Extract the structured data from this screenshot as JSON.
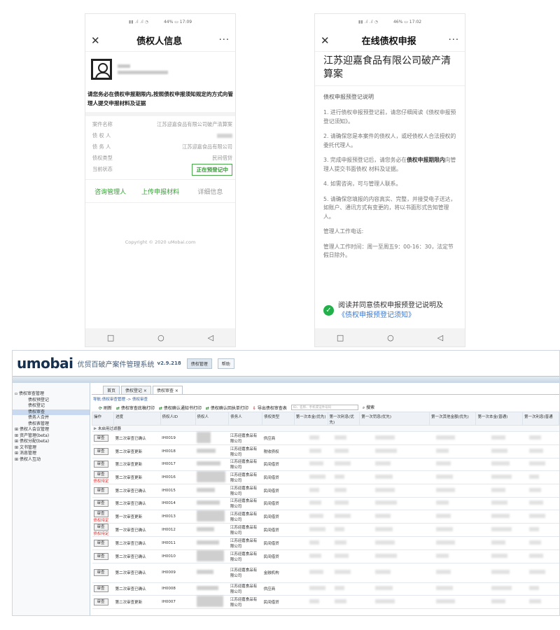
{
  "phone1": {
    "status_left": "44%",
    "status_time": "17:09",
    "title": "债权人信息",
    "close_icon": "close-icon",
    "more_icon": "more-icon",
    "notice": "请您务必在债权申报期限内,按照债权申报须知规定的方式向管理人提交申报材料及证据",
    "rows": [
      {
        "label": "案件名称",
        "value": "江苏迎嘉食品有限公司破产清算案"
      },
      {
        "label": "债 权 人",
        "value": ""
      },
      {
        "label": "债 务 人",
        "value": "江苏迎嘉食品有限公司"
      },
      {
        "label": "债权类型",
        "value": "民间借贷"
      },
      {
        "label": "当前状态",
        "value": "正在预登记中"
      }
    ],
    "actions": [
      "咨询管理人",
      "上传申报材料",
      "详细信息"
    ],
    "copyright": "Copyright © 2020 uMobai.com"
  },
  "phone2": {
    "status_left": "46%",
    "status_time": "17:02",
    "title": "在线债权申报",
    "case_title": "江苏迎嘉食品有限公司破产清算案",
    "section": "债权申报预登记说明",
    "paras": [
      "1. 进行债权申报预登记前，请您仔细阅读《债权申报预登记须知》。",
      "2. 请确保您是本案件的债权人，或经债权人合法授权的委托代理人。",
      "4. 如需咨询，可与管理人联系。",
      "5. 请确保您填报的内容真实、完整，并接受电子送达，如账户、通讯方式有变更的，将以书面形式告知管理人。",
      "管理人工作电话:",
      "管理人工作时间：周一至周五9：00-16：30，法定节假日除外。"
    ],
    "para3_pre": "3. 完成申报预登记后，请您务必在",
    "para3_bold": "债权申报期限内",
    "para3_post": "向管理人提交书面债权 材料及证据。",
    "agree_text": "阅读并同意债权申报预登记说明及",
    "agree_link": "《债权申报预登记须知》"
  },
  "desktop": {
    "logo": "umobai",
    "system_name": "优贸百破产案件管理系统",
    "version": "v2.9.218",
    "header_tabs": [
      "债权管理",
      "帮助"
    ],
    "sidebar": [
      {
        "label": "债权审查管理",
        "level": 0
      },
      {
        "label": "债权预登记",
        "level": 1
      },
      {
        "label": "债权登记",
        "level": 1
      },
      {
        "label": "债权审查",
        "level": 1,
        "selected": true
      },
      {
        "label": "债务人合并",
        "level": 1
      },
      {
        "label": "债权表管理",
        "level": 1
      },
      {
        "label": "债权人会议管理",
        "level": 0
      },
      {
        "label": "资产管理(beta)",
        "level": 0
      },
      {
        "label": "债权分配(beta)",
        "level": 0
      },
      {
        "label": "文书管理",
        "level": 0
      },
      {
        "label": "消息管理",
        "level": 0
      },
      {
        "label": "债权人互动",
        "level": 0
      }
    ],
    "tabs": [
      "首页",
      "债权登记 ×",
      "债权审查 ×"
    ],
    "breadcrumb": "导航:债权审查管理 -> 债权审查",
    "toolbar": [
      "刷新",
      "债权审查底稿打印",
      "债权确认通知书打印",
      "债权确认回执单打印",
      "导出债权审查表"
    ],
    "search_placeholder": "ID、名称、手机或证件号码",
    "search_button": "搜索",
    "columns": [
      "操作",
      "进度",
      "债权人ID",
      "债权人",
      "债务人",
      "债权类型",
      "第一次本金(优先)",
      "第一次利息(优先)",
      "第一次罚息(优先)",
      "第一次其他金额(优先)",
      "第一次本金(普通)",
      "第一次利息(普通"
    ],
    "filter_label": "未启用过滤器",
    "rows": [
      {
        "btn": "审查",
        "tag": "",
        "status": "第二次审查已确认",
        "id": "IH0019",
        "debtor": "江苏迎嘉食品有限公司",
        "type": "供应商"
      },
      {
        "btn": "审查",
        "tag": "",
        "status": "第二次审查更新",
        "id": "IH0018",
        "debtor": "江苏迎嘉食品有限公司",
        "type": "税收债权"
      },
      {
        "btn": "审查",
        "tag": "",
        "status": "第二次审查更新",
        "id": "IH0017",
        "debtor": "江苏迎嘉食品有限公司",
        "type": "民间借贷"
      },
      {
        "btn": "审查",
        "tag": "债权待定",
        "status": "第二次审查更新",
        "id": "IH0016",
        "debtor": "江苏迎嘉食品有限公司",
        "type": "民间借贷"
      },
      {
        "btn": "审查",
        "tag": "",
        "status": "第二次审查已确认",
        "id": "IH0015",
        "debtor": "江苏迎嘉食品有限公司",
        "type": "民间借贷"
      },
      {
        "btn": "审查",
        "tag": "",
        "status": "第二次审查已确认",
        "id": "IH0014",
        "debtor": "江苏迎嘉食品有限公司",
        "type": "民间借贷"
      },
      {
        "btn": "审查",
        "tag": "债权待定",
        "status": "第一次审查更新",
        "id": "IH0013",
        "debtor": "江苏迎嘉食品有限公司",
        "type": "民间借贷"
      },
      {
        "btn": "审查",
        "tag": "债权待定",
        "status": "第一次审查已确认",
        "id": "IH0012",
        "debtor": "江苏迎嘉食品有限公司",
        "type": "民间借贷"
      },
      {
        "btn": "审查",
        "tag": "",
        "status": "第二次审查已确认",
        "id": "IH0011",
        "debtor": "江苏迎嘉食品有限公司",
        "type": "民间借贷"
      },
      {
        "btn": "审查",
        "tag": "",
        "status": "第二次审查已确认",
        "id": "IH0010",
        "debtor": "江苏迎嘉食品有限公司",
        "type": "民间借贷"
      },
      {
        "btn": "审查",
        "tag": "",
        "status": "第二次审查已确认",
        "id": "IH0009",
        "debtor": "江苏迎嘉食品有限公司",
        "type": "金融机构"
      },
      {
        "btn": "审查",
        "tag": "",
        "status": "第二次审查已确认",
        "id": "IH0008",
        "debtor": "江苏迎嘉食品有限公司",
        "type": "供应商"
      },
      {
        "btn": "审查",
        "tag": "",
        "status": "第二次审查更新",
        "id": "IH0007",
        "debtor": "江苏迎嘉食品有限公司",
        "type": "民间借贷"
      }
    ]
  }
}
